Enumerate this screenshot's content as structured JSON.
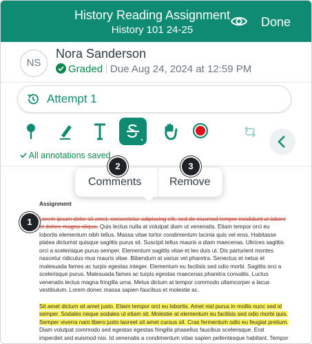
{
  "header": {
    "title": "History Reading Assignment",
    "subtitle": "History 101 24-25",
    "done_label": "Done"
  },
  "student": {
    "initials": "NS",
    "name": "Nora Sanderson",
    "status": "Graded",
    "due": "Due Aug 24, 2024 at 12:59 PM"
  },
  "attempt": {
    "label": "Attempt 1"
  },
  "toolbar": {
    "saved_label": "All annotations saved"
  },
  "context_menu": {
    "comments_label": "Comments",
    "remove_label": "Remove"
  },
  "callouts": {
    "one": "1",
    "two": "2",
    "three": "3"
  },
  "document": {
    "heading": "Assignment",
    "p1_strike": "Lorem ipsum dolor sit amet, consectetur adipiscing elit, sed do eiusmod tempor incididunt ut labore et dolore magna aliqua.",
    "p1_rest": " Quis lectus nulla at volutpat diam ut venenatis. Etiam tempor orci eu lobortis elementum nibh tellus. Massa vitae tortor condimentum lacinia quis vel eros. Habitasse platea dictumst quisque sagittis purus sit. Suscipit tellus mauris a diam maecenas. Ultrices sagittis orci a scelerisque purus semper. Elementum sagittis vitae et leo duis ut. Dis parturient montes nascetur ridiculus mus mauris vitae. Bibendum at varius vel pharetra. Senectus et netus et malesuada fames ac turpis egestas integer. Elementum eu facilisis sed odio morbi. Sagittis orci a scelerisque purus. Malesuada fames ac turpis egestas maecenas pharetra convallis. Luctus venenatis lectus magna fringilla urna. Metus dictum at tempor commodo ullamcorper a lacus vestibulum. Lorem donec massa sapien faucibus et molestie ac.",
    "p2_highlight": "Sit amet dictum sit amet justo. Etiam tempor orci eu lobortis. Amet nisl purus in mollis nunc sed id semper. Sodales neque sodales ut etiam sit. Molestie at elementum eu facilisis sed odio morbi quis. Semper viverra nam libero justo laoreet sit amet cursus sit. Cras fermentum odio eu feugiat pretium.",
    "p2_rest": " Diam volutpat commodo sed egestas egestas fringilla phasellus faucibus scelerisque. Erat imperdiet sed euismod nisi. Id venenatis a condimentum vitae sapien pellentesque habitant. Tempor orci eu lobortis elementum nibh. Netus et malesuada fames ac."
  },
  "colors": {
    "brand": "#0f8a73",
    "graded": "#0b874b",
    "annotation_red": "#e0101a",
    "highlight": "#fff45a"
  },
  "icons": [
    "eye-icon",
    "check-circle-icon",
    "history-icon",
    "pin-icon",
    "highlighter-icon",
    "text-icon",
    "strikethrough-icon",
    "hand-icon",
    "record-icon",
    "undo-redo-icon",
    "chevron-left-icon",
    "check-icon"
  ]
}
